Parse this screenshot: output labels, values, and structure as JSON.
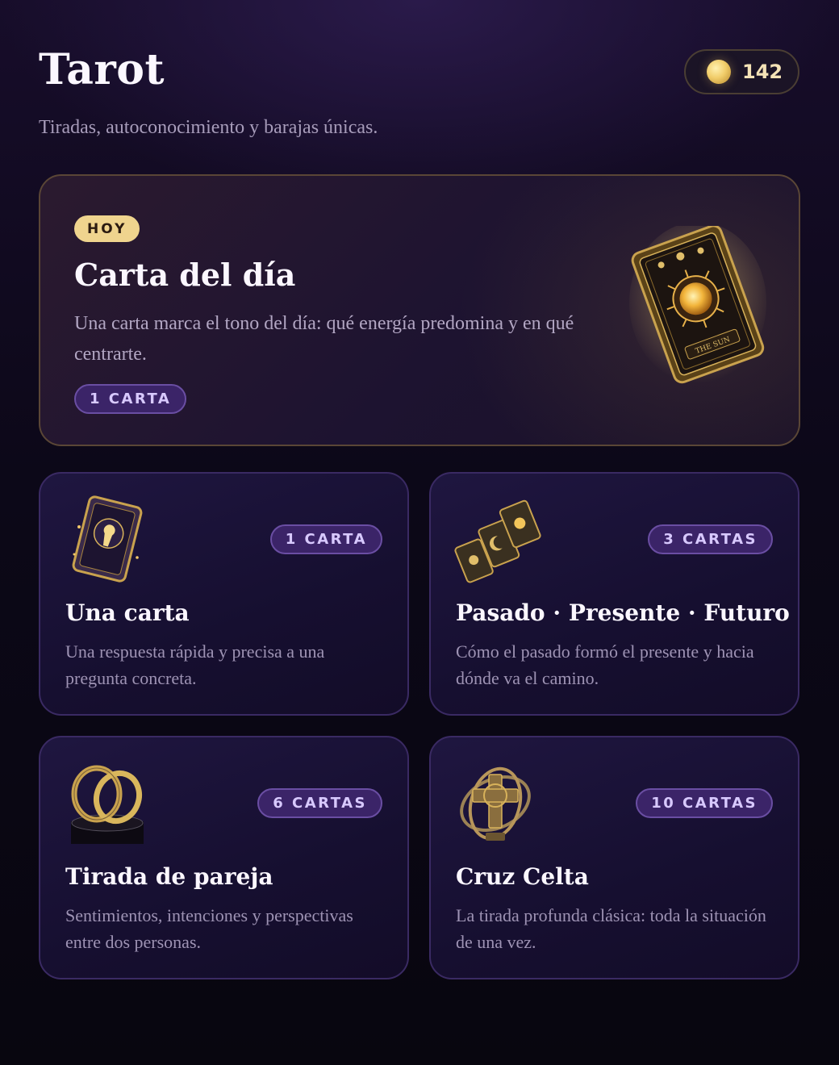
{
  "header": {
    "title": "Tarot",
    "subtitle": "Tiradas, autoconocimiento y barajas únicas.",
    "coins": "142"
  },
  "daily": {
    "badge": "HOY",
    "title": "Carta del día",
    "description": "Una carta marca el tono del día: qué energía predomina y en qué centrarte.",
    "count": "1 CARTA",
    "card_caption": "THE SUN"
  },
  "spreads": [
    {
      "title": "Una carta",
      "description": "Una respuesta rápida y precisa a una pregunta concreta.",
      "count": "1 CARTA",
      "icon": "keyhole-card-icon"
    },
    {
      "title": "Pasado · Presente · Futuro",
      "description": "Cómo el pasado formó el presente y hacia dónde va el camino.",
      "count": "3 CARTAS",
      "icon": "three-cards-icon"
    },
    {
      "title": "Tirada de pareja",
      "description": "Sentimientos, intenciones y perspectivas entre dos personas.",
      "count": "6 CARTAS",
      "icon": "interlocked-rings-icon"
    },
    {
      "title": "Cruz Celta",
      "description": "La tirada profunda clásica: toda la situación de una vez.",
      "count": "10 CARTAS",
      "icon": "celtic-cross-icon"
    }
  ],
  "colors": {
    "accent_gold": "#efd48e",
    "pill_bg": "#3b2468",
    "pill_text": "#d8c9ff"
  }
}
